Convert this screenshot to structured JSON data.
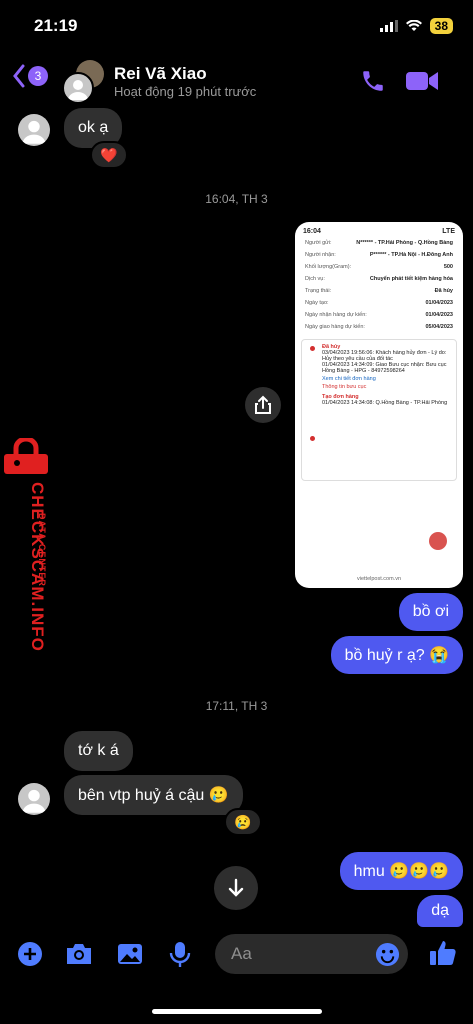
{
  "status": {
    "time": "21:19",
    "battery": "38"
  },
  "header": {
    "back_count": "3",
    "name": "Rei Vã Xiao",
    "subtitle": "Hoạt động 19 phút trước"
  },
  "messages": {
    "in_1": "ok ạ",
    "in_1_reaction": "❤️",
    "stamp_1": "16:04, TH 3",
    "out_1": "bồ ơi",
    "out_2": "bồ huỷ r ạ? 😭",
    "stamp_2": "17:11, TH 3",
    "in_2": "tớ k á",
    "in_3": "bên vtp huỷ á cậu 🥲",
    "in_3_reaction": "😢",
    "out_3": "hmu 🥲🥲🥲",
    "out_4": "dạ"
  },
  "screenshot": {
    "time": "16:04",
    "network": "LTE",
    "sender_label": "Người gửi:",
    "sender_value": "N****** - TP.Hải Phòng - Q.Hồng Bàng",
    "receiver_label": "Người nhận:",
    "receiver_value": "P****** - TP.Hà Nội - H.Đông Anh",
    "weight_label": "Khối lượng(Gram):",
    "weight_value": "500",
    "service_label": "Dịch vụ:",
    "service_value": "Chuyển phát tiết kiệm hàng hóa",
    "state_label": "Trạng thái:",
    "state_value": "Đã hủy",
    "created_label": "Ngày tạo:",
    "created_value": "01/04/2023",
    "pickup_label": "Ngày nhận hàng dự kiến:",
    "pickup_value": "01/04/2023",
    "delivery_label": "Ngày giao hàng dự kiến:",
    "delivery_value": "05/04/2023",
    "tl1_title": "Đã hủy",
    "tl1_text1": "03/04/2023 19:56:06: Khách hàng hủy đơn - Lý do: Hủy theo yêu cầu của đối tác",
    "tl1_text2": "01/04/2023 14:34:09: Giao Bưu cục nhận: Bưu cục Hồng Bàng - HPG - 84972598264",
    "tl1_link": "Xem chi tiết đơn hàng",
    "tl1_link2": "Thông tin bưu cục",
    "tl2_title": "Tạo đơn hàng",
    "tl2_text": "01/04/2023 14:34:08: Q.Hồng Bàng - TP.Hải Phòng",
    "footer": "viettelpost.com.vn"
  },
  "watermark": {
    "main": "CHECKSCAM.INFO",
    "sub": "DATA CENTER"
  },
  "composer": {
    "placeholder": "Aa"
  },
  "colors": {
    "accent": "#8d63f9",
    "outgoing": "#4f59f0",
    "incoming": "#303030",
    "watermark": "#e02020"
  }
}
